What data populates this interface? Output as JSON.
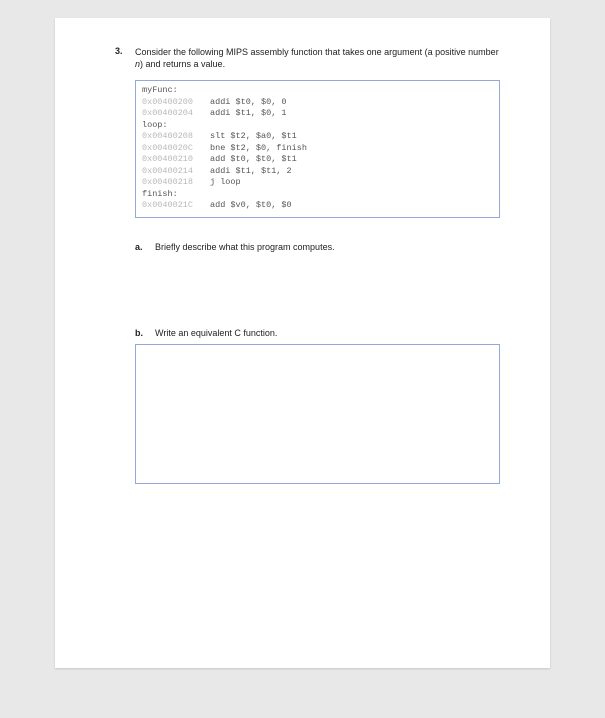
{
  "question": {
    "number": "3.",
    "prompt_a": "Consider the following MIPS assembly function that takes one argument (a positive number ",
    "prompt_n": "n",
    "prompt_b": ") and returns a value."
  },
  "code": {
    "l0_label": "myFunc:",
    "l1_addr": "0x00400200",
    "l1_instr": "addi $t0, $0, 0",
    "l2_addr": "0x00400204",
    "l2_instr": "addi $t1, $0, 1",
    "l3_label": "loop:",
    "l4_addr": "0x00400208",
    "l4_instr": "slt  $t2, $a0, $t1",
    "l5_addr": "0x0040020C",
    "l5_instr": "bne  $t2, $0, finish",
    "l6_addr": "0x00400210",
    "l6_instr": "add  $t0, $t0, $t1",
    "l7_addr": "0x00400214",
    "l7_instr": "addi $t1, $t1, 2",
    "l8_addr": "0x00400218",
    "l8_instr": "j    loop",
    "l9_label": "finish:",
    "l10_addr": "0x0040021C",
    "l10_instr": "add $v0, $t0, $0"
  },
  "sub_a": {
    "letter": "a.",
    "text": "Briefly describe what this program computes."
  },
  "sub_b": {
    "letter": "b.",
    "text": "Write an equivalent C function."
  }
}
